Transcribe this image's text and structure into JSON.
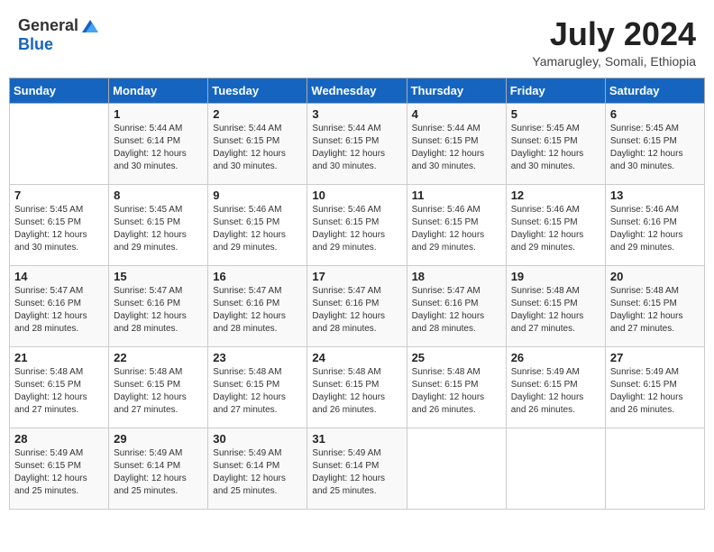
{
  "header": {
    "logo_general": "General",
    "logo_blue": "Blue",
    "month_year": "July 2024",
    "location": "Yamarugley, Somali, Ethiopia"
  },
  "days_of_week": [
    "Sunday",
    "Monday",
    "Tuesday",
    "Wednesday",
    "Thursday",
    "Friday",
    "Saturday"
  ],
  "weeks": [
    [
      {
        "day": "",
        "info": ""
      },
      {
        "day": "1",
        "info": "Sunrise: 5:44 AM\nSunset: 6:14 PM\nDaylight: 12 hours\nand 30 minutes."
      },
      {
        "day": "2",
        "info": "Sunrise: 5:44 AM\nSunset: 6:15 PM\nDaylight: 12 hours\nand 30 minutes."
      },
      {
        "day": "3",
        "info": "Sunrise: 5:44 AM\nSunset: 6:15 PM\nDaylight: 12 hours\nand 30 minutes."
      },
      {
        "day": "4",
        "info": "Sunrise: 5:44 AM\nSunset: 6:15 PM\nDaylight: 12 hours\nand 30 minutes."
      },
      {
        "day": "5",
        "info": "Sunrise: 5:45 AM\nSunset: 6:15 PM\nDaylight: 12 hours\nand 30 minutes."
      },
      {
        "day": "6",
        "info": "Sunrise: 5:45 AM\nSunset: 6:15 PM\nDaylight: 12 hours\nand 30 minutes."
      }
    ],
    [
      {
        "day": "7",
        "info": "Sunrise: 5:45 AM\nSunset: 6:15 PM\nDaylight: 12 hours\nand 30 minutes."
      },
      {
        "day": "8",
        "info": "Sunrise: 5:45 AM\nSunset: 6:15 PM\nDaylight: 12 hours\nand 29 minutes."
      },
      {
        "day": "9",
        "info": "Sunrise: 5:46 AM\nSunset: 6:15 PM\nDaylight: 12 hours\nand 29 minutes."
      },
      {
        "day": "10",
        "info": "Sunrise: 5:46 AM\nSunset: 6:15 PM\nDaylight: 12 hours\nand 29 minutes."
      },
      {
        "day": "11",
        "info": "Sunrise: 5:46 AM\nSunset: 6:15 PM\nDaylight: 12 hours\nand 29 minutes."
      },
      {
        "day": "12",
        "info": "Sunrise: 5:46 AM\nSunset: 6:15 PM\nDaylight: 12 hours\nand 29 minutes."
      },
      {
        "day": "13",
        "info": "Sunrise: 5:46 AM\nSunset: 6:16 PM\nDaylight: 12 hours\nand 29 minutes."
      }
    ],
    [
      {
        "day": "14",
        "info": "Sunrise: 5:47 AM\nSunset: 6:16 PM\nDaylight: 12 hours\nand 28 minutes."
      },
      {
        "day": "15",
        "info": "Sunrise: 5:47 AM\nSunset: 6:16 PM\nDaylight: 12 hours\nand 28 minutes."
      },
      {
        "day": "16",
        "info": "Sunrise: 5:47 AM\nSunset: 6:16 PM\nDaylight: 12 hours\nand 28 minutes."
      },
      {
        "day": "17",
        "info": "Sunrise: 5:47 AM\nSunset: 6:16 PM\nDaylight: 12 hours\nand 28 minutes."
      },
      {
        "day": "18",
        "info": "Sunrise: 5:47 AM\nSunset: 6:16 PM\nDaylight: 12 hours\nand 28 minutes."
      },
      {
        "day": "19",
        "info": "Sunrise: 5:48 AM\nSunset: 6:15 PM\nDaylight: 12 hours\nand 27 minutes."
      },
      {
        "day": "20",
        "info": "Sunrise: 5:48 AM\nSunset: 6:15 PM\nDaylight: 12 hours\nand 27 minutes."
      }
    ],
    [
      {
        "day": "21",
        "info": "Sunrise: 5:48 AM\nSunset: 6:15 PM\nDaylight: 12 hours\nand 27 minutes."
      },
      {
        "day": "22",
        "info": "Sunrise: 5:48 AM\nSunset: 6:15 PM\nDaylight: 12 hours\nand 27 minutes."
      },
      {
        "day": "23",
        "info": "Sunrise: 5:48 AM\nSunset: 6:15 PM\nDaylight: 12 hours\nand 27 minutes."
      },
      {
        "day": "24",
        "info": "Sunrise: 5:48 AM\nSunset: 6:15 PM\nDaylight: 12 hours\nand 26 minutes."
      },
      {
        "day": "25",
        "info": "Sunrise: 5:48 AM\nSunset: 6:15 PM\nDaylight: 12 hours\nand 26 minutes."
      },
      {
        "day": "26",
        "info": "Sunrise: 5:49 AM\nSunset: 6:15 PM\nDaylight: 12 hours\nand 26 minutes."
      },
      {
        "day": "27",
        "info": "Sunrise: 5:49 AM\nSunset: 6:15 PM\nDaylight: 12 hours\nand 26 minutes."
      }
    ],
    [
      {
        "day": "28",
        "info": "Sunrise: 5:49 AM\nSunset: 6:15 PM\nDaylight: 12 hours\nand 25 minutes."
      },
      {
        "day": "29",
        "info": "Sunrise: 5:49 AM\nSunset: 6:14 PM\nDaylight: 12 hours\nand 25 minutes."
      },
      {
        "day": "30",
        "info": "Sunrise: 5:49 AM\nSunset: 6:14 PM\nDaylight: 12 hours\nand 25 minutes."
      },
      {
        "day": "31",
        "info": "Sunrise: 5:49 AM\nSunset: 6:14 PM\nDaylight: 12 hours\nand 25 minutes."
      },
      {
        "day": "",
        "info": ""
      },
      {
        "day": "",
        "info": ""
      },
      {
        "day": "",
        "info": ""
      }
    ]
  ]
}
